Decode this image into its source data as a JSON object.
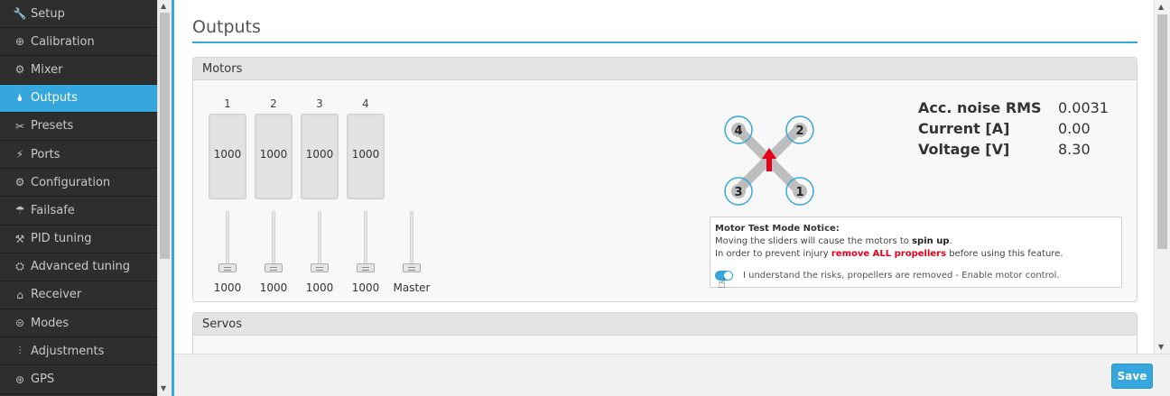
{
  "sidebar": {
    "items": [
      {
        "label": "Setup",
        "icon": "wrench-icon",
        "glyph": "🔧"
      },
      {
        "label": "Calibration",
        "icon": "crosshair-icon",
        "glyph": "⊕"
      },
      {
        "label": "Mixer",
        "icon": "mixer-icon",
        "glyph": "⚙"
      },
      {
        "label": "Outputs",
        "icon": "bolt-icon",
        "glyph": "🌢"
      },
      {
        "label": "Presets",
        "icon": "tools-icon",
        "glyph": "✂"
      },
      {
        "label": "Ports",
        "icon": "plug-icon",
        "glyph": "⚡"
      },
      {
        "label": "Configuration",
        "icon": "gear-icon",
        "glyph": "⚙"
      },
      {
        "label": "Failsafe",
        "icon": "parachute-icon",
        "glyph": "☂"
      },
      {
        "label": "PID tuning",
        "icon": "tuning-icon",
        "glyph": "⚒"
      },
      {
        "label": "Advanced tuning",
        "icon": "sliders-icon",
        "glyph": "⛭"
      },
      {
        "label": "Receiver",
        "icon": "receiver-icon",
        "glyph": "⌂"
      },
      {
        "label": "Modes",
        "icon": "toggle-icon",
        "glyph": "⊜"
      },
      {
        "label": "Adjustments",
        "icon": "adjust-icon",
        "glyph": "⫶"
      },
      {
        "label": "GPS",
        "icon": "satellite-icon",
        "glyph": "⊛"
      }
    ],
    "active_index": 3
  },
  "page": {
    "title": "Outputs"
  },
  "motors": {
    "header": "Motors",
    "columns": [
      {
        "num": "1",
        "bar_value": "1000",
        "slider_value": "1000"
      },
      {
        "num": "2",
        "bar_value": "1000",
        "slider_value": "1000"
      },
      {
        "num": "3",
        "bar_value": "1000",
        "slider_value": "1000"
      },
      {
        "num": "4",
        "bar_value": "1000",
        "slider_value": "1000"
      }
    ],
    "master_label": "Master",
    "quad_labels": [
      "4",
      "2",
      "3",
      "1"
    ],
    "stats": [
      {
        "label": "Acc. noise RMS",
        "value": "0.0031"
      },
      {
        "label": "Current [A]",
        "value": "0.00"
      },
      {
        "label": "Voltage [V]",
        "value": "8.30"
      }
    ],
    "notice": {
      "title": "Motor Test Mode Notice:",
      "line1_a": "Moving the sliders will cause the motors to ",
      "line1_b": "spin up",
      "line1_c": ".",
      "line2_a": "In order to prevent injury ",
      "line2_b": "remove ALL propellers",
      "line2_c": " before using this feature.",
      "toggle_label": "I understand the risks, propellers are removed - Enable motor control."
    }
  },
  "servos": {
    "header": "Servos"
  },
  "footer": {
    "save_label": "Save"
  },
  "colors": {
    "accent": "#36a7dc",
    "sidebar_bg": "#2b2b2b",
    "warning": "#e3001b"
  }
}
